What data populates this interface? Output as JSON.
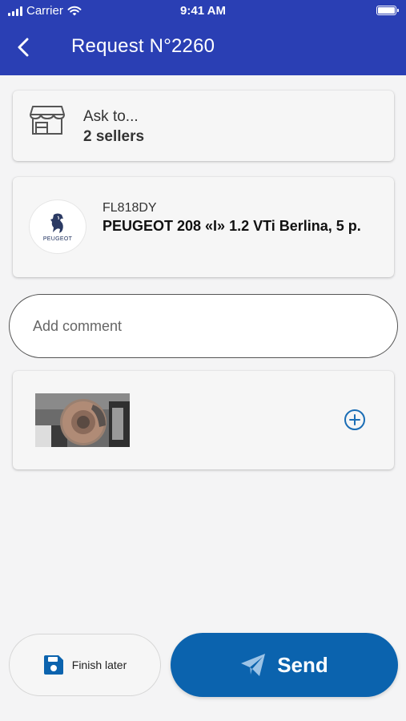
{
  "status_bar": {
    "carrier": "Carrier",
    "time": "9:41 AM"
  },
  "header": {
    "title": "Request N°2260",
    "color": "#2a3fb4"
  },
  "sellers_card": {
    "ask_label": "Ask to...",
    "count_label": "2 sellers",
    "icon": "store-icon"
  },
  "vehicle_card": {
    "plate": "FL818DY",
    "model": "PEUGEOT 208 «I» 1.2 VTi Berlina, 5 p.",
    "brand": "PEUGEOT"
  },
  "comment": {
    "placeholder": "Add comment",
    "value": ""
  },
  "photos": {
    "items": [
      {
        "subject": "brake disc photo"
      }
    ],
    "add_icon": "add-circle-icon"
  },
  "actions": {
    "finish_later_label": "Finish later",
    "send_label": "Send",
    "send_color": "#0b63ae"
  }
}
